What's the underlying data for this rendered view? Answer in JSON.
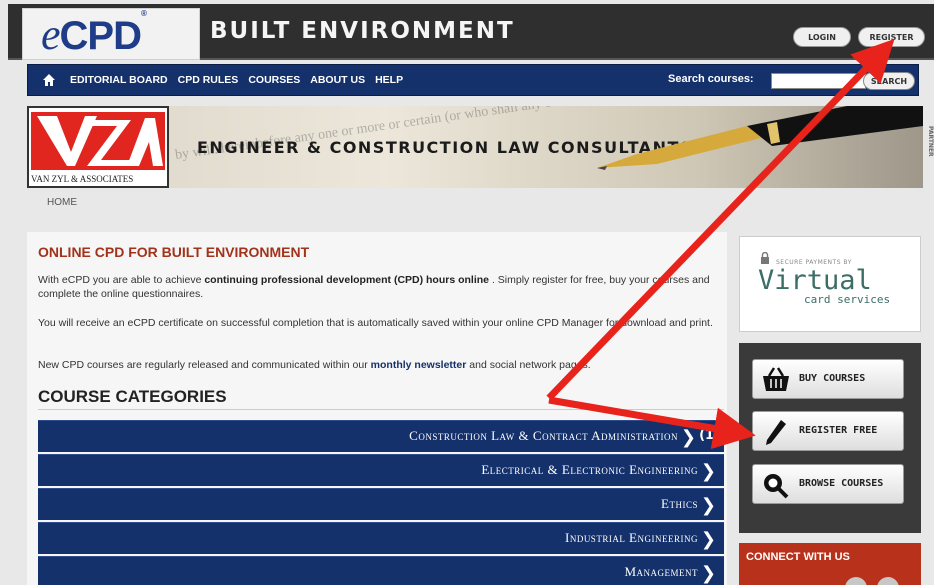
{
  "header": {
    "logo_e": "e",
    "logo_cpd": "CPD",
    "logo_reg": "®",
    "site_title": "BUILT ENVIRONMENT",
    "login_label": "LOGIN",
    "register_label": "REGISTER"
  },
  "nav": {
    "items": [
      "EDITORIAL BOARD",
      "CPD RULES",
      "COURSES",
      "ABOUT US",
      "HELP"
    ],
    "search_label": "Search courses:",
    "search_value": "",
    "search_button": "SEARCH"
  },
  "banner": {
    "partner_caption": "VAN ZYL & ASSOCIATES",
    "partner_initials": "VZA",
    "title": "ENGINEER & CONSTRUCTION LAW CONSULTANTS",
    "side_tag": "PARTNER",
    "bg_text": "by will. hereinbefore any one or more or certain (or who shall any of them in any of them"
  },
  "breadcrumb": {
    "home": "HOME"
  },
  "main": {
    "title": "ONLINE CPD FOR BUILT ENVIRONMENT",
    "p1_a": "With eCPD you are able to achieve ",
    "p1_b": "continuing professional development (CPD) hours online",
    "p1_c": " .  Simply register for free, buy your courses and complete the online questionnaires.",
    "p2": "You will receive an eCPD certificate on successful completion that is automatically saved within your online CPD Manager for download and print.",
    "p3_a": "New CPD courses are regularly released and communicated within our ",
    "p3_b": "monthly newsletter",
    "p3_c": " and social network pages.",
    "categories_title": "COURSE CATEGORIES",
    "categories": [
      {
        "label": "Construction Law & Contract Administration",
        "count": "(1)"
      },
      {
        "label": "Electrical & Electronic Engineering",
        "count": ""
      },
      {
        "label": "Ethics",
        "count": ""
      },
      {
        "label": "Industrial Engineering",
        "count": ""
      },
      {
        "label": "Management",
        "count": ""
      }
    ]
  },
  "sidebar": {
    "secure_text": "SECURE PAYMENTS BY",
    "virtual": "Virtual",
    "card_services": "card services",
    "buy_courses": "BUY COURSES",
    "register_free": "REGISTER FREE",
    "browse_courses": "BROWSE COURSES",
    "connect": "CONNECT WITH US"
  },
  "colors": {
    "nav_blue": "#14316b",
    "title_red": "#a2331b",
    "arrow_red": "#e8231b",
    "dark_header": "#2f2f2f"
  }
}
